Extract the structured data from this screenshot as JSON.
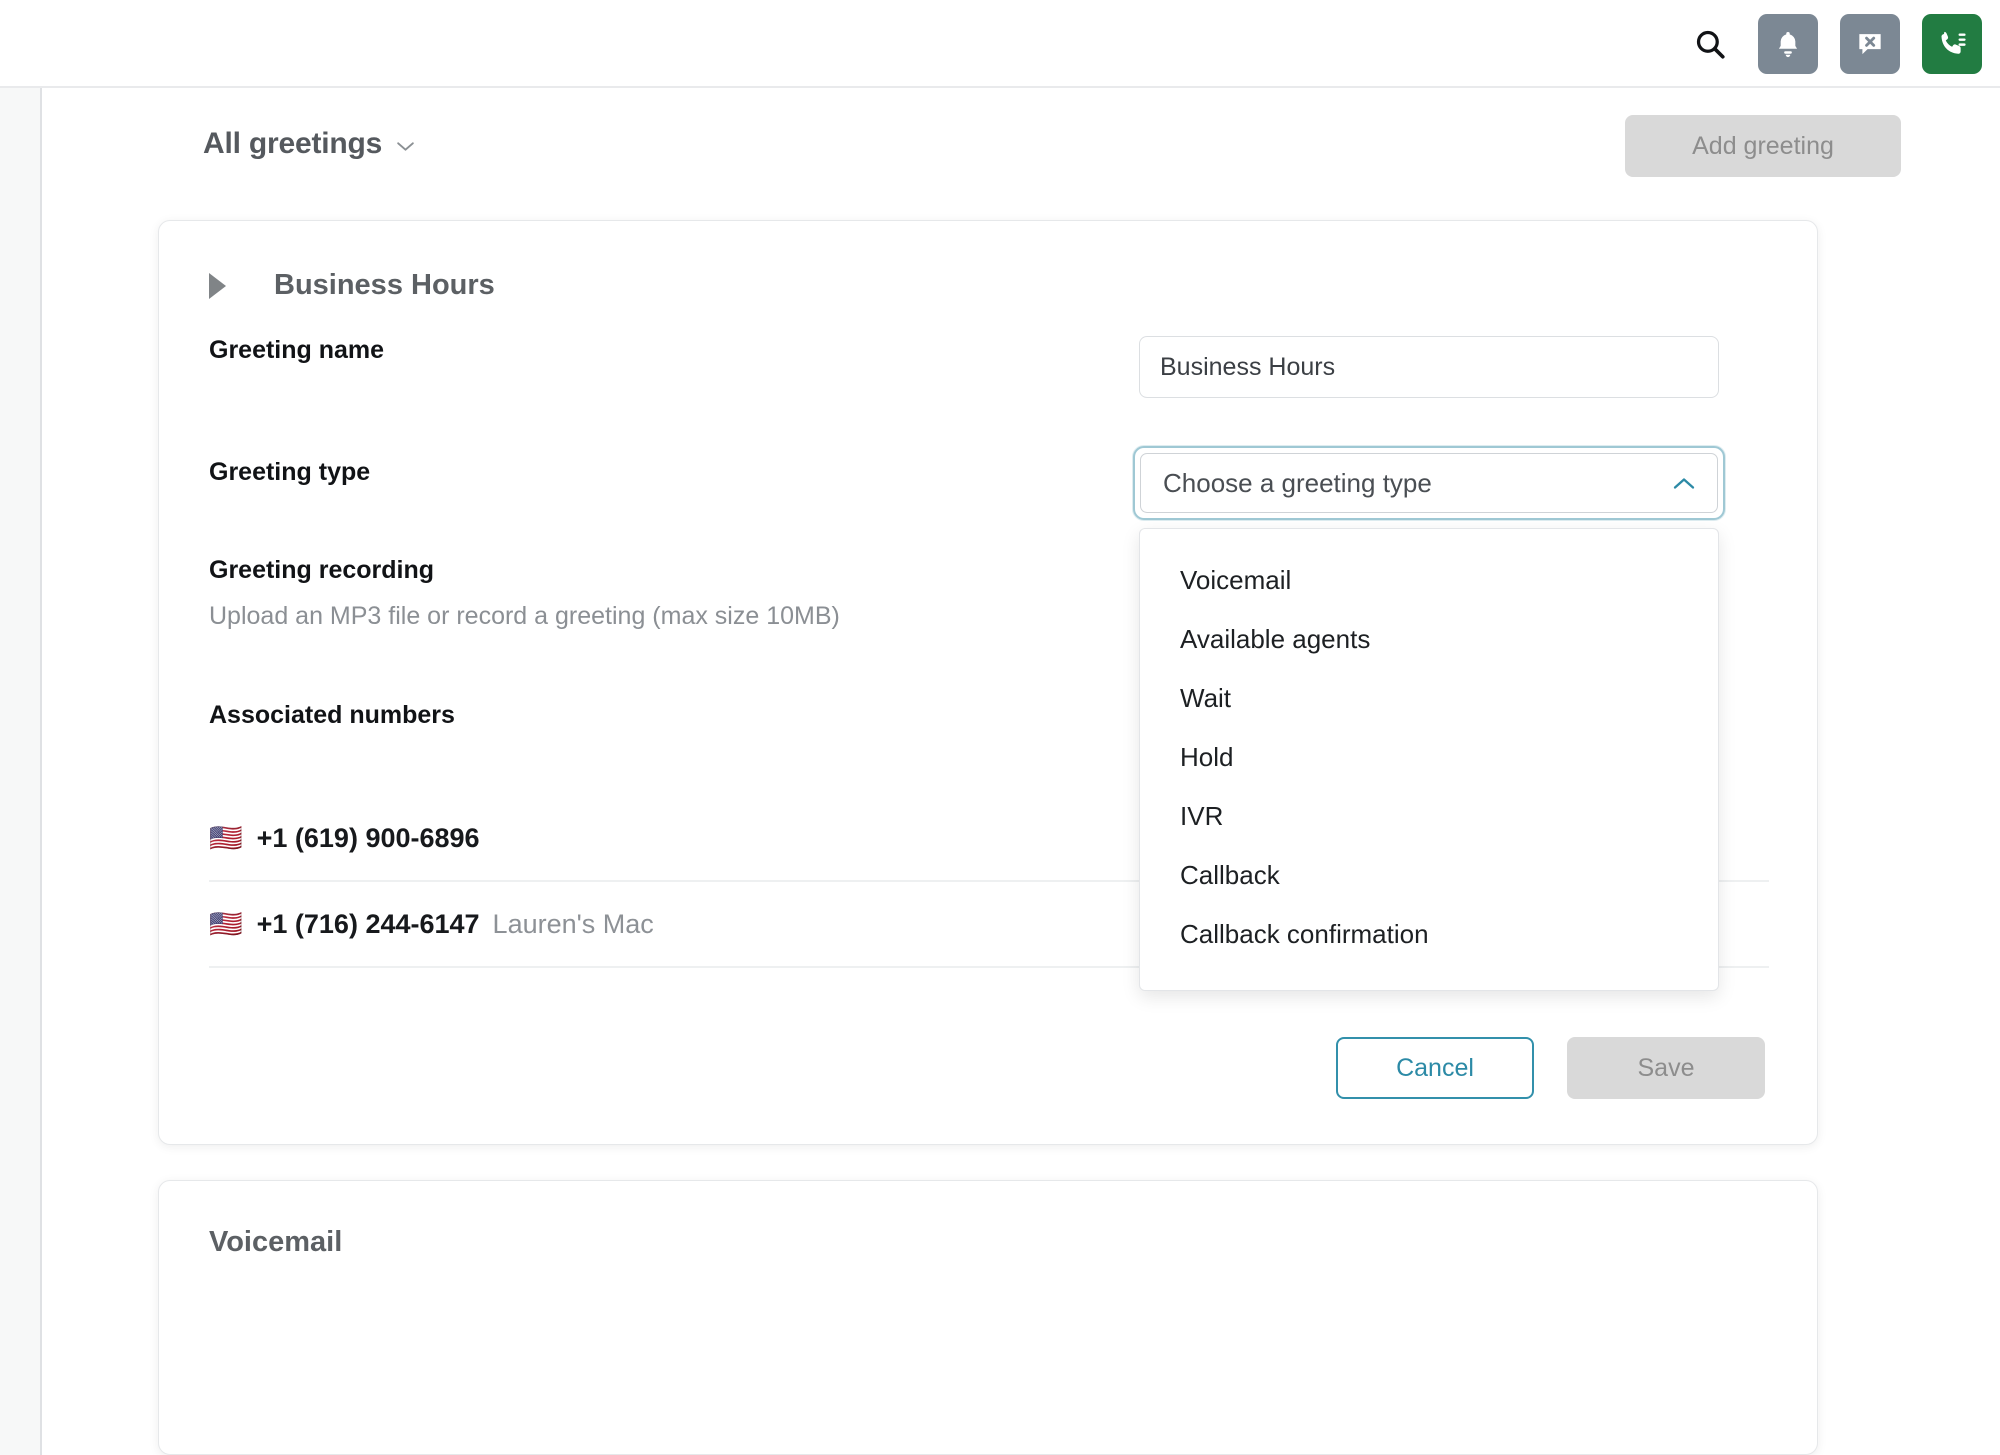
{
  "topbar": {
    "icons": [
      {
        "name": "search-icon",
        "label": "Search"
      },
      {
        "name": "bell-icon",
        "label": "Notifications"
      },
      {
        "name": "chat-dismiss-icon",
        "label": "Messages"
      },
      {
        "name": "phone-call-icon",
        "label": "Call"
      }
    ],
    "colors": {
      "gray_button": "#7c8894",
      "green_button": "#227c42"
    }
  },
  "page": {
    "filter_label": "All greetings",
    "filter_chevron": "chevron-down-icon",
    "add_button_label": "Add greeting"
  },
  "greeting_card": {
    "expand_caret": "caret-right-icon",
    "title": "Business Hours",
    "fields": {
      "greeting_name_label": "Greeting name",
      "greeting_name_value": "Business Hours",
      "greeting_name_placeholder": "Greeting name",
      "greeting_type_label": "Greeting type",
      "greeting_type_value": "Choose a greeting type",
      "greeting_type_chevron": "chevron-up-icon",
      "recording_label": "Greeting recording",
      "recording_help": "Upload an MP3 file or record a greeting (max size 10MB)",
      "associated_numbers_label": "Associated numbers"
    },
    "greeting_type_options": [
      "Voicemail",
      "Available agents",
      "Wait",
      "Hold",
      "IVR",
      "Callback",
      "Callback confirmation"
    ],
    "numbers": [
      {
        "flag": "🇺🇸",
        "number": "+1 (619) 900-6896",
        "device": ""
      },
      {
        "flag": "🇺🇸",
        "number": "+1 (716) 244-6147",
        "device": "Lauren's Mac"
      }
    ],
    "footer": {
      "cancel_label": "Cancel",
      "save_label": "Save"
    }
  },
  "next_card": {
    "title": "Voicemail"
  },
  "colors": {
    "accent_teal": "#2c8aa6",
    "focus_ring": "#9fc8d4",
    "disabled_bg": "#d9d9d9",
    "toggle_off": "#6f757a"
  }
}
